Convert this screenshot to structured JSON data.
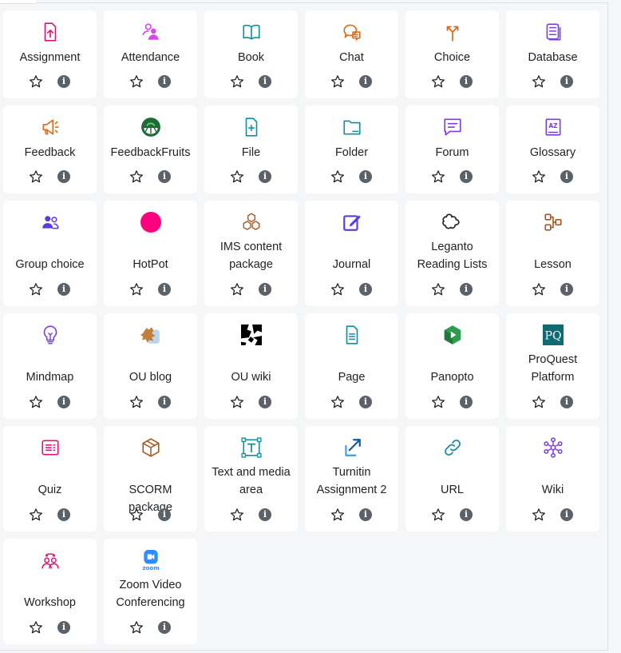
{
  "modules": [
    {
      "id": "assignment",
      "label": "Assignment",
      "icon": "assignment-icon",
      "color": "#e2127a"
    },
    {
      "id": "attendance",
      "label": "Attendance",
      "icon": "attendance-icon",
      "color": "#d946ef"
    },
    {
      "id": "book",
      "label": "Book",
      "icon": "book-icon",
      "color": "#0e8fa3"
    },
    {
      "id": "chat",
      "label": "Chat",
      "icon": "chat-icon",
      "color": "#e06a14"
    },
    {
      "id": "choice",
      "label": "Choice",
      "icon": "choice-icon",
      "color": "#e06a14"
    },
    {
      "id": "database",
      "label": "Database",
      "icon": "database-icon",
      "color": "#7d3cdc"
    },
    {
      "id": "feedback",
      "label": "Feedback",
      "icon": "feedback-icon",
      "color": "#e06a14"
    },
    {
      "id": "feedbackfruits",
      "label": "FeedbackFruits",
      "icon": "feedbackfruits-icon",
      "color": "#1e6b3a"
    },
    {
      "id": "file",
      "label": "File",
      "icon": "file-icon",
      "color": "#0e8fa3"
    },
    {
      "id": "folder",
      "label": "Folder",
      "icon": "folder-icon",
      "color": "#0e8fa3"
    },
    {
      "id": "forum",
      "label": "Forum",
      "icon": "forum-icon",
      "color": "#7d3cdc"
    },
    {
      "id": "glossary",
      "label": "Glossary",
      "icon": "glossary-icon",
      "color": "#7d3cdc"
    },
    {
      "id": "groupchoice",
      "label": "Group choice",
      "icon": "group-choice-icon",
      "color": "#5b3cdc"
    },
    {
      "id": "hotpot",
      "label": "HotPot",
      "icon": "hotpot-icon",
      "color": "#ff0080"
    },
    {
      "id": "ims",
      "label": "IMS content package",
      "icon": "ims-package-icon",
      "color": "#a9551e"
    },
    {
      "id": "journal",
      "label": "Journal",
      "icon": "journal-icon",
      "color": "#5b3cdc"
    },
    {
      "id": "leganto",
      "label": "Leganto Reading Lists",
      "icon": "leganto-icon",
      "color": "#222222"
    },
    {
      "id": "lesson",
      "label": "Lesson",
      "icon": "lesson-icon",
      "color": "#a9551e"
    },
    {
      "id": "mindmap",
      "label": "Mindmap",
      "icon": "mindmap-icon",
      "color": "#7d3cdc"
    },
    {
      "id": "oublog",
      "label": "OU blog",
      "icon": "ou-blog-icon",
      "color": "#c0803a"
    },
    {
      "id": "ouwiki",
      "label": "OU wiki",
      "icon": "ou-wiki-icon",
      "color": "#000000"
    },
    {
      "id": "page",
      "label": "Page",
      "icon": "page-icon",
      "color": "#0e8fa3"
    },
    {
      "id": "panopto",
      "label": "Panopto",
      "icon": "panopto-icon",
      "color": "#2e9e4e"
    },
    {
      "id": "proquest",
      "label": "ProQuest Platform",
      "icon": "proquest-icon",
      "color": "#0e6b72"
    },
    {
      "id": "quiz",
      "label": "Quiz",
      "icon": "quiz-icon",
      "color": "#e2127a"
    },
    {
      "id": "scorm",
      "label": "SCORM package",
      "icon": "scorm-icon",
      "color": "#a9551e"
    },
    {
      "id": "textmedia",
      "label": "Text and media area",
      "icon": "text-media-icon",
      "color": "#0e8fa3"
    },
    {
      "id": "turnitin",
      "label": "Turnitin Assignment 2",
      "icon": "turnitin-icon",
      "color": "#0a5aa8"
    },
    {
      "id": "url",
      "label": "URL",
      "icon": "url-icon",
      "color": "#0e8fa3"
    },
    {
      "id": "wiki",
      "label": "Wiki",
      "icon": "wiki-icon",
      "color": "#7d3cdc"
    },
    {
      "id": "workshop",
      "label": "Workshop",
      "icon": "workshop-icon",
      "color": "#e2127a"
    },
    {
      "id": "zoom",
      "label": "Zoom Video Conferencing",
      "icon": "zoom-icon",
      "color": "#2d8cff"
    }
  ],
  "info_glyph": "i"
}
